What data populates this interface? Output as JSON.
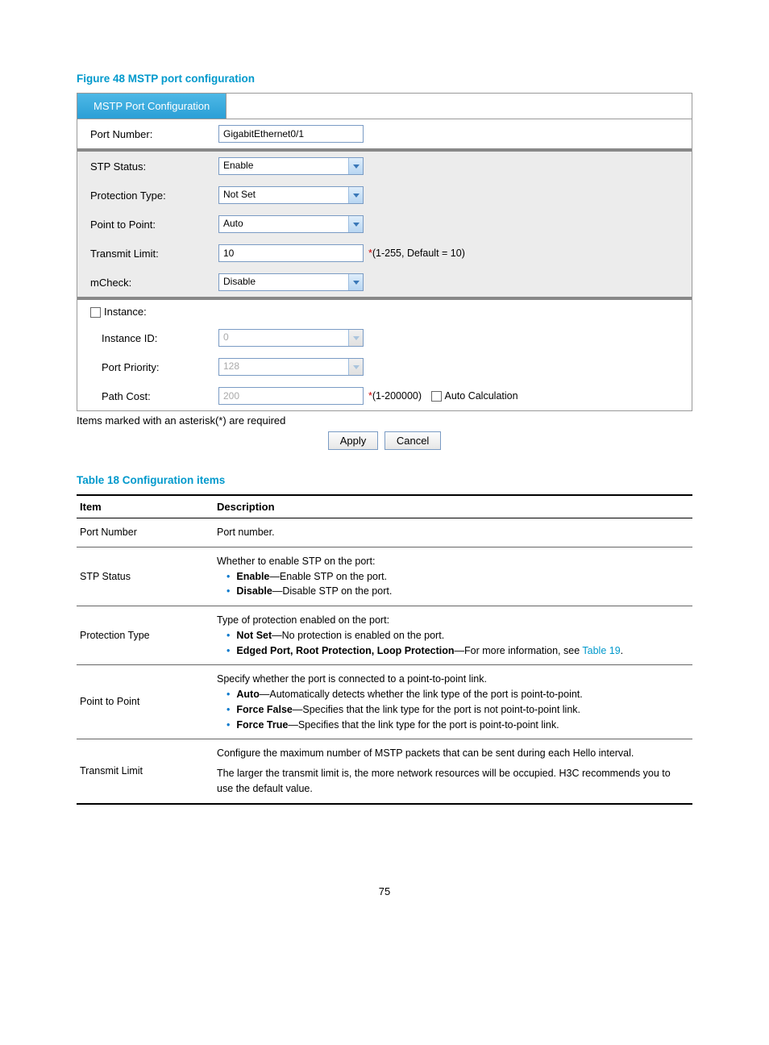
{
  "figure": {
    "title": "Figure 48 MSTP port configuration"
  },
  "panel": {
    "tab": "MSTP Port Configuration",
    "port_number_label": "Port Number:",
    "port_number_value": "GigabitEthernet0/1",
    "stp_status_label": "STP Status:",
    "stp_status_value": "Enable",
    "protection_label": "Protection Type:",
    "protection_value": "Not Set",
    "ptp_label": "Point to Point:",
    "ptp_value": "Auto",
    "transmit_label": "Transmit Limit:",
    "transmit_value": "10",
    "transmit_hint": "(1-255, Default = 10)",
    "mcheck_label": "mCheck:",
    "mcheck_value": "Disable",
    "instance_label": "Instance:",
    "instance_id_label": "Instance ID:",
    "instance_id_value": "0",
    "port_priority_label": "Port Priority:",
    "port_priority_value": "128",
    "path_cost_label": "Path Cost:",
    "path_cost_value": "200",
    "path_cost_hint": "(1-200000)",
    "auto_calc_label": "Auto Calculation",
    "note": "Items marked with an asterisk(*) are required",
    "apply_btn": "Apply",
    "cancel_btn": "Cancel"
  },
  "table": {
    "title": "Table 18 Configuration items",
    "headers": {
      "item": "Item",
      "desc": "Description"
    },
    "rows": {
      "r0": {
        "item": "Port Number",
        "desc": "Port number."
      },
      "r1": {
        "item": "STP Status",
        "intro": "Whether to enable STP on the port:",
        "b1a": "Enable",
        "b1b": "—Enable STP on the port.",
        "b2a": "Disable",
        "b2b": "—Disable STP on the port."
      },
      "r2": {
        "item": "Protection Type",
        "intro": "Type of protection enabled on the port:",
        "b1a": "Not Set",
        "b1b": "—No protection is enabled on the port.",
        "b2a": "Edged Port, Root Protection, Loop Protection",
        "b2b": "—For more information, see ",
        "link": "Table 19",
        "after": "."
      },
      "r3": {
        "item": "Point to Point",
        "intro": "Specify whether the port is connected to a point-to-point link.",
        "b1a": "Auto",
        "b1b": "—Automatically detects whether the link type of the port is point-to-point.",
        "b2a": "Force False",
        "b2b": "—Specifies that the link type for the port is not point-to-point link.",
        "b3a": "Force True",
        "b3b": "—Specifies that the link type for the port is point-to-point link."
      },
      "r4": {
        "item": "Transmit Limit",
        "p1": "Configure the maximum number of MSTP packets that can be sent during each Hello interval.",
        "p2": "The larger the transmit limit is, the more network resources will be occupied. H3C recommends you to use the default value."
      }
    }
  },
  "page_number": "75"
}
